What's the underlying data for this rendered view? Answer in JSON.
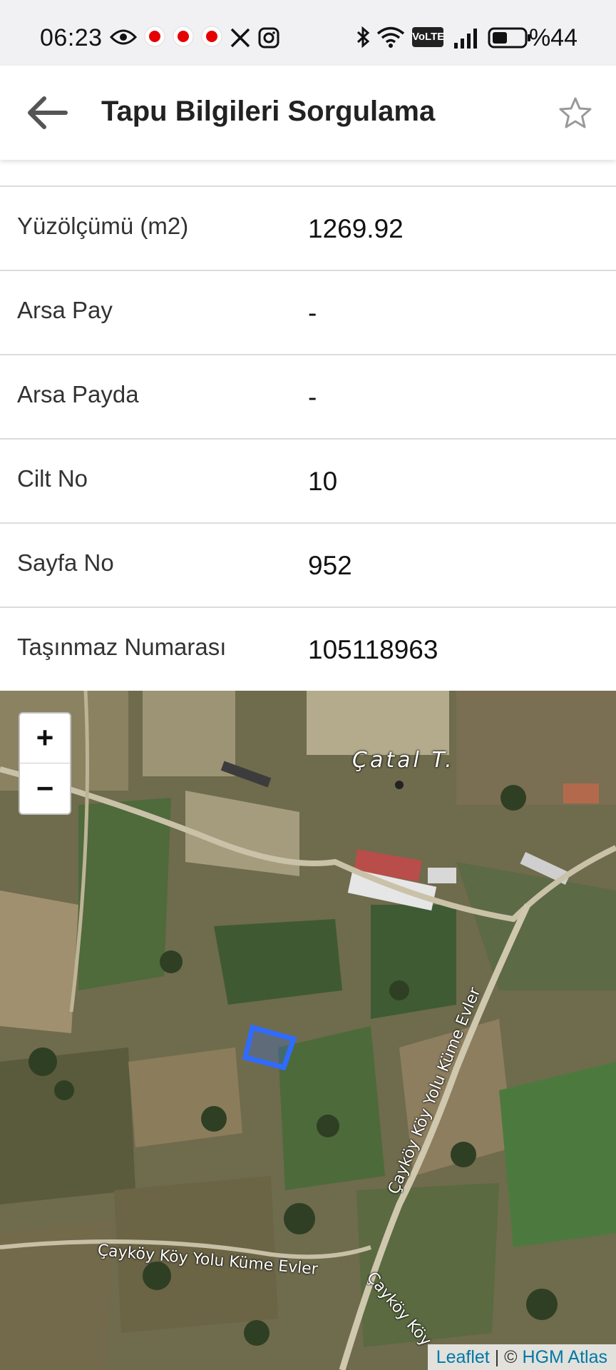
{
  "status_bar": {
    "time": "06:23",
    "battery_percent": "%44",
    "icons": [
      "eye-icon",
      "vodafone-icon",
      "vodafone-icon",
      "vodafone-icon",
      "x-icon",
      "instagram-icon",
      "bluetooth-icon",
      "wifi-icon",
      "volte-icon",
      "signal-icon",
      "battery-icon"
    ],
    "volte_label": "VoLTE"
  },
  "app_bar": {
    "title": "Tapu Bilgileri Sorgulama",
    "back_icon": "arrow-left-icon",
    "favorite_icon": "star-outline-icon"
  },
  "info_rows": [
    {
      "label": "Yüzölçümü (m2)",
      "value": "1269.92"
    },
    {
      "label": "Arsa Pay",
      "value": "-"
    },
    {
      "label": "Arsa Payda",
      "value": "-"
    },
    {
      "label": "Cilt No",
      "value": "10"
    },
    {
      "label": "Sayfa No",
      "value": "952"
    },
    {
      "label": "Taşınmaz Numarası",
      "value": "105118963"
    }
  ],
  "map": {
    "zoom_in_label": "+",
    "zoom_out_label": "−",
    "place_label": "Çatal T.",
    "road_label_1": "Çayköy Köy Yolu Küme Evler",
    "road_label_2": "Çayköy Köy Yolu Küme Evler",
    "road_label_3": "Çayköy Köy",
    "attribution_leaflet": "Leaflet",
    "attribution_sep": " | © ",
    "attribution_source": "HGM Atlas",
    "parcel_color": "#2f6bff"
  }
}
